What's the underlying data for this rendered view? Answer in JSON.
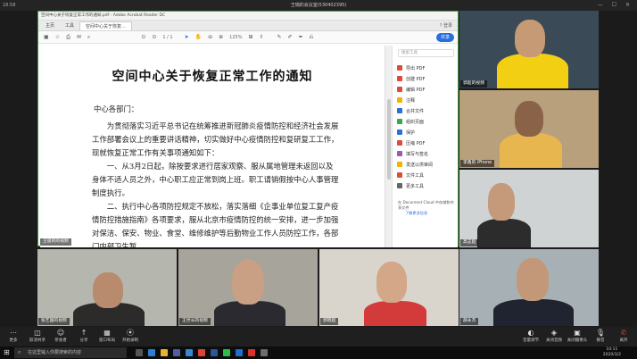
{
  "window": {
    "title": "王瑞的会议室(530402395)",
    "left_label": "18:58",
    "controls": "— ☐ ✕"
  },
  "reader": {
    "title_text": "空间中心关于恢复正常工作的通知.pdf - Adobe Acrobat Reader DC",
    "tabs": [
      {
        "label": "主页"
      },
      {
        "label": "工具"
      },
      {
        "label": "空间中心关于恢复..."
      }
    ],
    "tab_right": "? 登录",
    "page_indicator": "1 / 1",
    "zoom": "125%",
    "share_button": "共享",
    "doc_title": "空间中心关于恢复正常工作的通知",
    "greeting": "中心各部门：",
    "paragraphs": [
      "为贯彻落实习近平总书记在统筹推进新冠肺炎疫情防控和经济社会发展工作部署会议上的重要讲话精神，切实做好中心疫情防控和复研复工工作，现就恢复正常工作有关事项通知如下：",
      "一、从3月2日起，除按要求进行居家观察、服从属地管理未返回以及身体不适人员之外，中心职工应正常到岗上班。职工请销假按中心人事管理制度执行。",
      "二、执行中心各项防控规定不放松，落实落细《企事业单位复工复产疫情防控措施指南》各项要求，服从北京市疫情防控的统一安排，进一步加强对保洁、保安、物业、食堂、维修维护等后勤物业工作人员防控工作，各部门内部卫生暂"
    ],
    "sidebar": {
      "search_placeholder": "搜索工具",
      "items": [
        {
          "label": "导出 PDF",
          "color": "#e04a3c"
        },
        {
          "label": "创建 PDF",
          "color": "#e04a3c"
        },
        {
          "label": "编辑 PDF",
          "color": "#e04a3c"
        },
        {
          "label": "注释",
          "color": "#f2b400"
        },
        {
          "label": "合并文件",
          "color": "#2a6fdb"
        },
        {
          "label": "组织页面",
          "color": "#35a853"
        },
        {
          "label": "保护",
          "color": "#2a6fdb"
        },
        {
          "label": "压缩 PDF",
          "color": "#e04a3c"
        },
        {
          "label": "填写与签名",
          "color": "#9b59b6"
        },
        {
          "label": "发送以供审阅",
          "color": "#f2b400"
        },
        {
          "label": "文件工具",
          "color": "#e04a3c"
        },
        {
          "label": "更多工具",
          "color": "#666666"
        }
      ],
      "note": "在 Document Cloud 中存储和共享文件",
      "link": "了解更多信息"
    }
  },
  "participants": [
    {
      "name": "王俊的的视频"
    },
    {
      "name": "郭超的视频"
    },
    {
      "name": "李鑫的 iPhone"
    },
    {
      "name": "高志超"
    },
    {
      "name": "张艺国的视频"
    },
    {
      "name": "王世长的视频"
    },
    {
      "name": "郭晓超"
    },
    {
      "name": "薛永杰"
    }
  ],
  "toolbar": {
    "left": [
      {
        "icon": "⋯",
        "label": "更多"
      },
      {
        "icon": "◫",
        "label": "取消共享"
      },
      {
        "icon": "☺",
        "label": "参会者"
      },
      {
        "icon": "↑",
        "label": "分享"
      },
      {
        "icon": "▦",
        "label": "窗口布局"
      },
      {
        "icon": "⦿",
        "label": "开始录制"
      }
    ],
    "right": [
      {
        "icon": "◐",
        "label": "音量调节"
      },
      {
        "icon": "◈",
        "label": "关闭音频"
      },
      {
        "icon": "▣",
        "label": "关闭摄像头"
      },
      {
        "icon": "🎙",
        "label": "静音"
      },
      {
        "icon": "✆",
        "label": "离开"
      }
    ]
  },
  "taskbar": {
    "search_placeholder": "在这里输入你要搜索的内容",
    "time": "10:11",
    "date": "2020/3/2"
  }
}
